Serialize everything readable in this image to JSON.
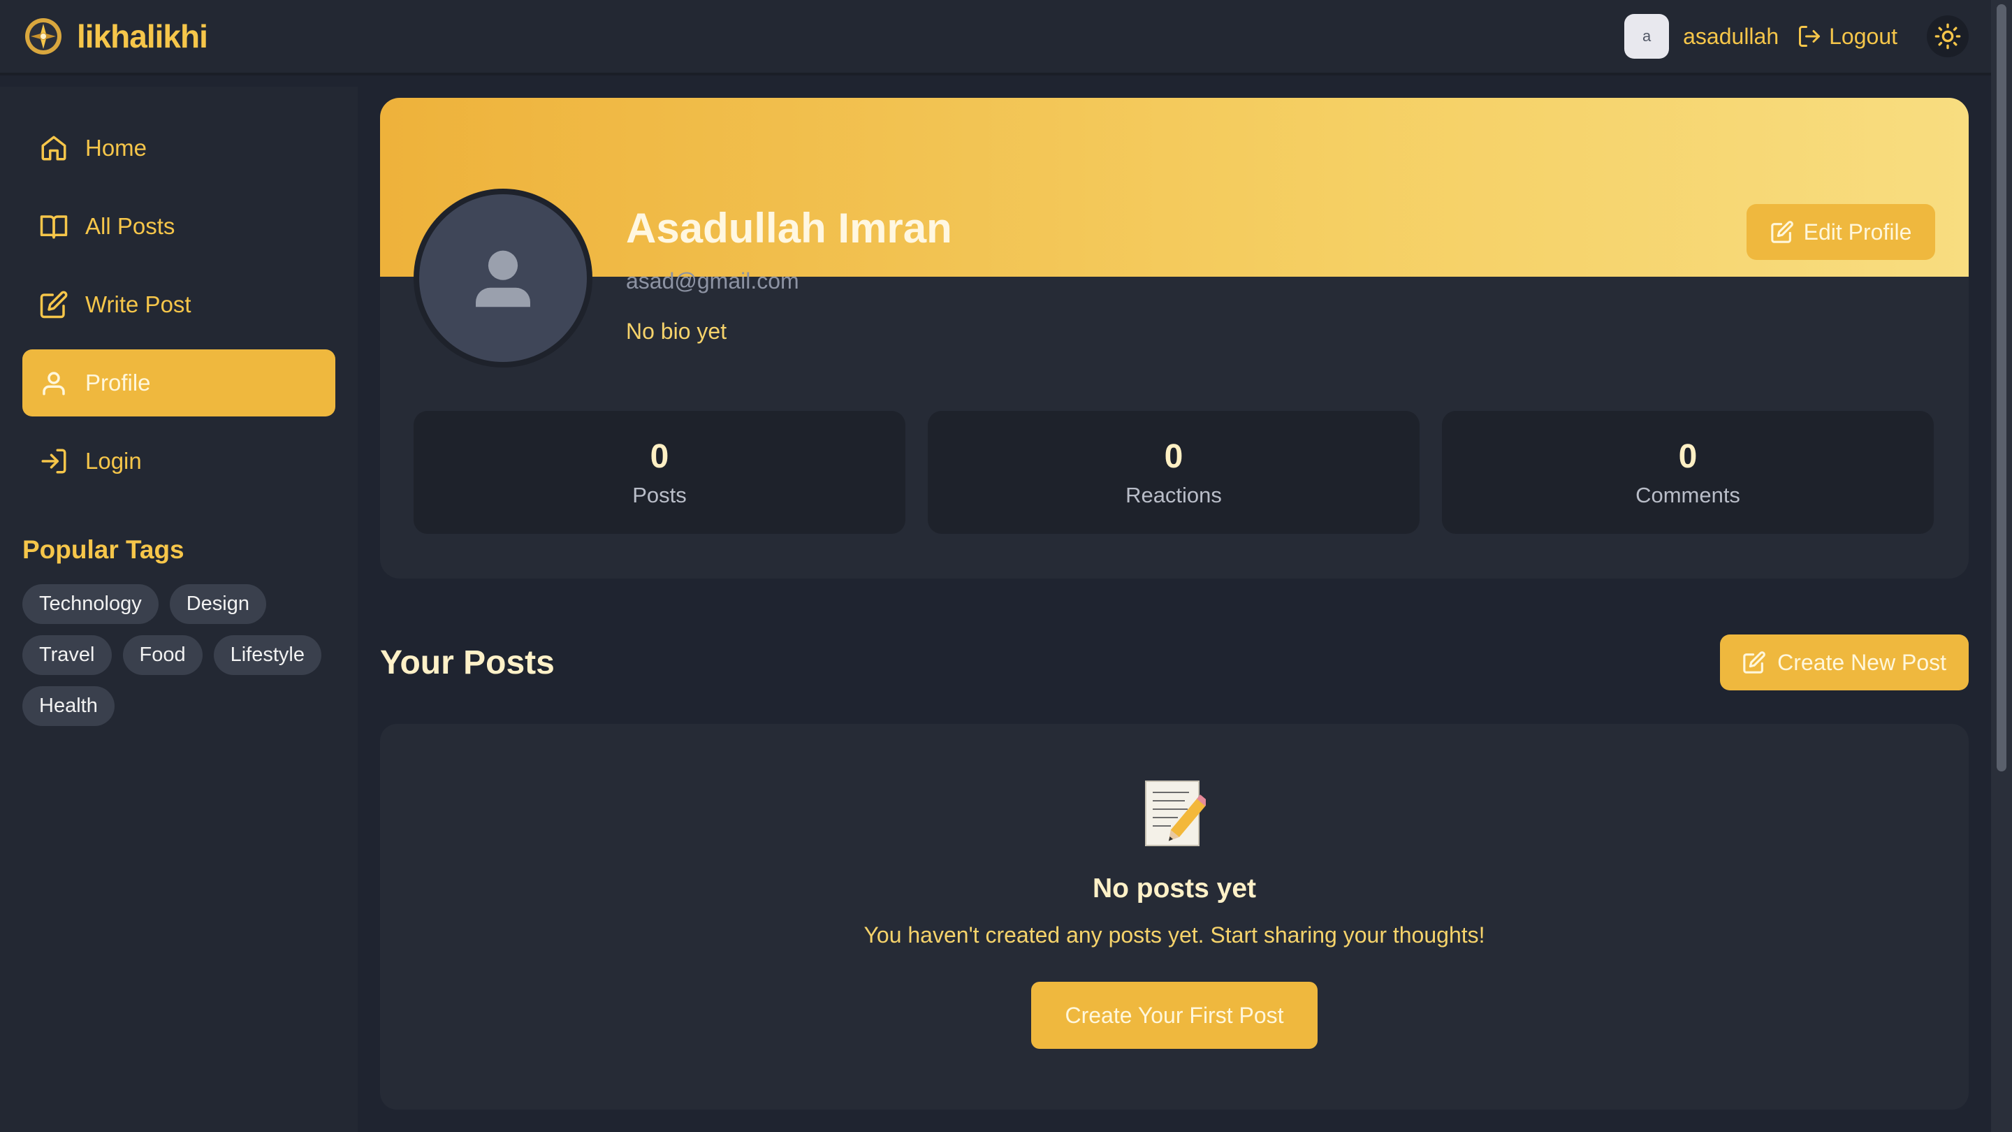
{
  "header": {
    "brand": "likhalikhi",
    "avatar_initial": "a",
    "username": "asadullah",
    "logout_label": "Logout"
  },
  "sidebar": {
    "items": [
      {
        "label": "Home",
        "icon": "home-icon"
      },
      {
        "label": "All Posts",
        "icon": "book-icon"
      },
      {
        "label": "Write Post",
        "icon": "edit-icon"
      },
      {
        "label": "Profile",
        "icon": "user-icon",
        "active": true
      },
      {
        "label": "Login",
        "icon": "login-icon"
      }
    ],
    "tags_title": "Popular Tags",
    "tags": [
      "Technology",
      "Design",
      "Travel",
      "Food",
      "Lifestyle",
      "Health"
    ]
  },
  "profile": {
    "name": "Asadullah Imran",
    "email": "asad@gmail.com",
    "bio": "No bio yet",
    "edit_label": "Edit Profile",
    "stats": [
      {
        "value": "0",
        "label": "Posts"
      },
      {
        "value": "0",
        "label": "Reactions"
      },
      {
        "value": "0",
        "label": "Comments"
      }
    ]
  },
  "posts": {
    "title": "Your Posts",
    "create_label": "Create New Post",
    "empty_title": "No posts yet",
    "empty_text": "You haven't created any posts yet. Start sharing your thoughts!",
    "first_post_label": "Create Your First Post"
  },
  "colors": {
    "accent": "#efb83e",
    "background": "#1f2430",
    "panel": "#262b36"
  }
}
